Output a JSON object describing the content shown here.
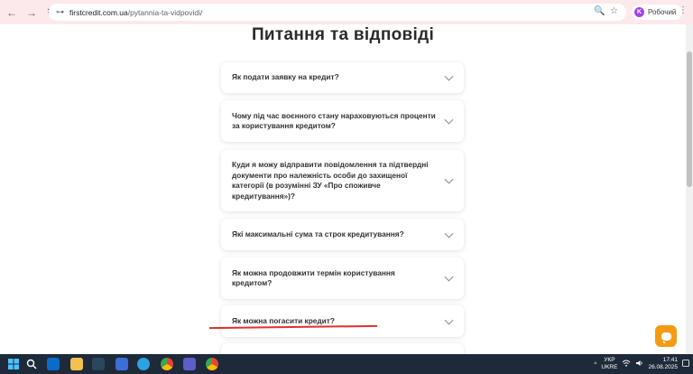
{
  "browser": {
    "back_glyph": "←",
    "forward_glyph": "→",
    "reload_glyph": "↻",
    "tune_glyph": "⊶",
    "url_domain": "firstcredit.com.ua",
    "url_path": "/pytannia-ta-vidpovidi/",
    "zoom_glyph": "🔍",
    "star_glyph": "☆",
    "profile_initial": "K",
    "profile_label": "Робочий",
    "menu_glyph": "⋮"
  },
  "page": {
    "title": "Питання та відповіді",
    "faq": [
      {
        "question": "Як подати заявку на кредит?"
      },
      {
        "question": "Чому під час воєнного стану нараховуються проценти за користування кредитом?"
      },
      {
        "question": "Куди я можу відправити повідомлення та підтвердні документи про належність особи до захищеної категорії (в розумінні ЗУ «Про споживче кредитування»)?"
      },
      {
        "question": "Які максимальні сума та строк кредитування?"
      },
      {
        "question": "Як можна продовжити термін користування кредитом?"
      },
      {
        "question": "Як можна погасити кредит?"
      }
    ]
  },
  "colors": {
    "accent": "#f39c12",
    "annotation": "#e03131",
    "browser_bar": "#fbe9ec",
    "taskbar": "#1e2a3a"
  },
  "taskbar": {
    "icons": [
      "windows-icon",
      "search-icon",
      "mail-icon",
      "file-explorer-icon",
      "steam-icon",
      "store-icon",
      "telegram-icon",
      "chrome-icon",
      "teams-icon",
      "chrome-active-icon"
    ],
    "tray_arrow": "^",
    "lang_top": "УКР",
    "lang_bottom": "UKRE",
    "time": "17:41",
    "date": "26.08.2025"
  }
}
